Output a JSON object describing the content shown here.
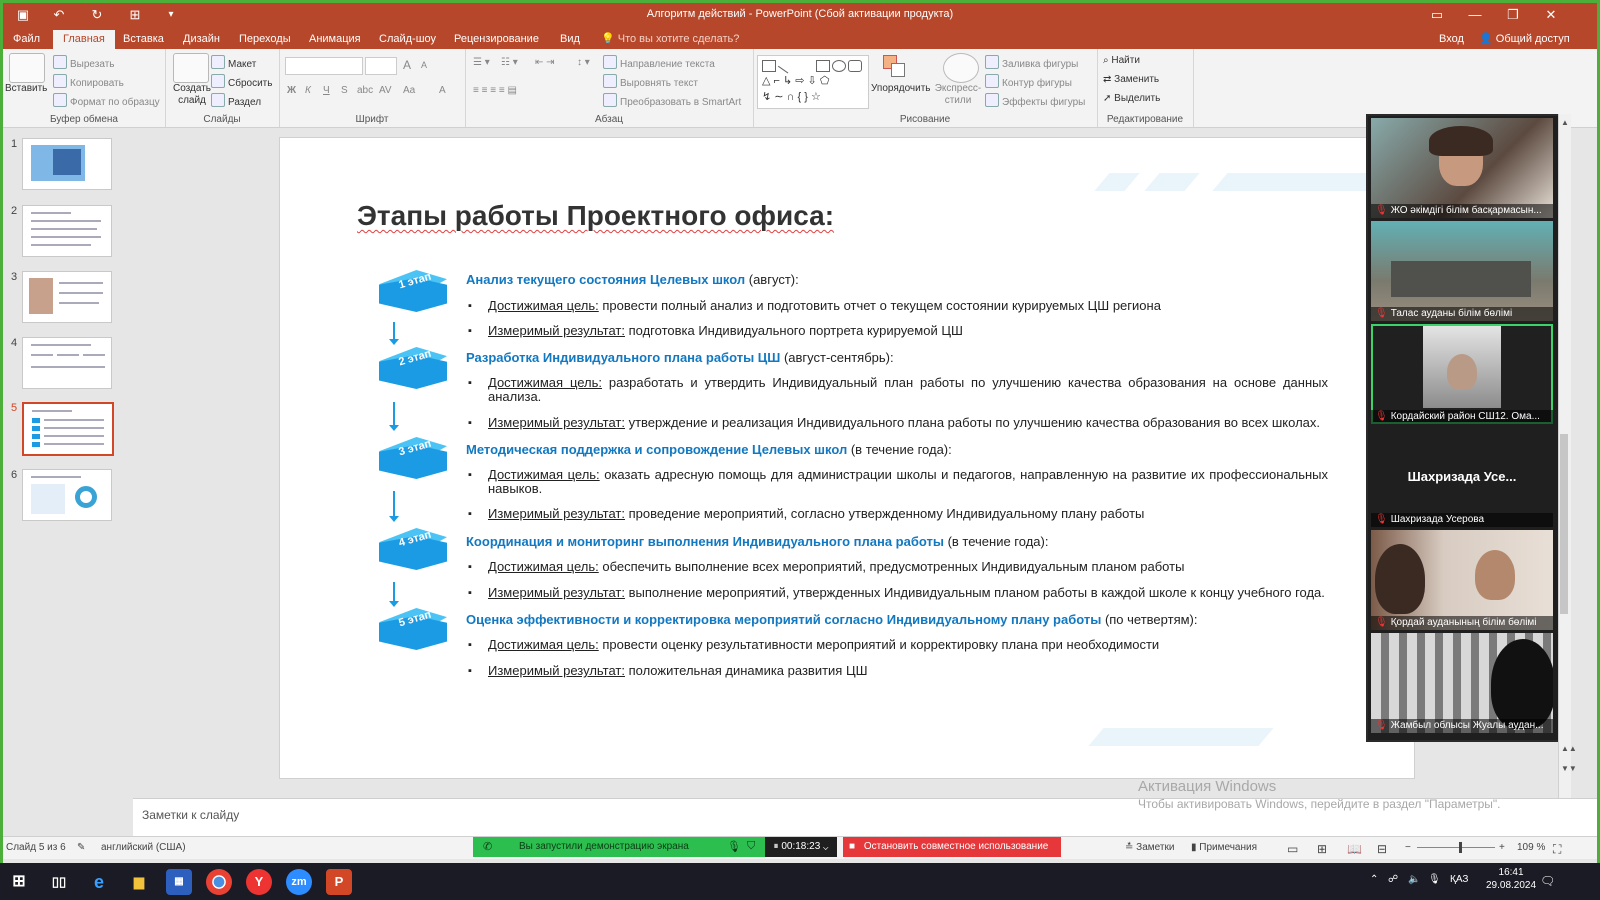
{
  "window": {
    "title": "Алгоритм действий - PowerPoint (Сбой активации продукта)"
  },
  "tabs": [
    "Файл",
    "Главная",
    "Вставка",
    "Дизайн",
    "Переходы",
    "Анимация",
    "Слайд-шоу",
    "Рецензирование",
    "Вид"
  ],
  "tell_me": "Что вы хотите сделать?",
  "account": {
    "signin": "Вход",
    "share": "Общий доступ"
  },
  "ribbon": {
    "clipboard": {
      "label": "Буфер обмена",
      "paste": "Вставить",
      "cut": "Вырезать",
      "copy": "Копировать",
      "format_painter": "Формат по образцу"
    },
    "slides": {
      "label": "Слайды",
      "new_slide": "Создать слайд",
      "layout": "Макет",
      "reset": "Сбросить",
      "section": "Раздел"
    },
    "font": {
      "label": "Шрифт",
      "bold": "Ж",
      "italic": "К",
      "underline": "Ч",
      "strike": "S",
      "shadow": "abc",
      "spacing": "AV",
      "case": "Aa",
      "grow": "A",
      "shrink": "A",
      "color": "A"
    },
    "paragraph": {
      "label": "Абзац",
      "text_direction": "Направление текста",
      "align_text": "Выровнять текст",
      "smartart": "Преобразовать в SmartArt"
    },
    "drawing": {
      "label": "Рисование",
      "arrange": "Упорядочить",
      "quick_styles": "Экспресс-стили",
      "fill": "Заливка фигуры",
      "outline": "Контур фигуры",
      "effects": "Эффекты фигуры"
    },
    "editing": {
      "label": "Редактирование",
      "find": "Найти",
      "replace": "Заменить",
      "select": "Выделить"
    }
  },
  "thumbnails": [
    "1",
    "2",
    "3",
    "4",
    "5",
    "6"
  ],
  "selected_slide": 5,
  "slide": {
    "title": "Этапы работы Проектного офиса:",
    "stages": [
      {
        "badge": "1 этап",
        "title": "Анализ текущего состояния Целевых школ",
        "period": " (август):",
        "goal_label": "Достижимая цель:",
        "goal": " провести полный анализ и подготовить отчет о текущем состоянии курируемых ЦШ региона",
        "result_label": "Измеримый результат:",
        "result": " подготовка Индивидуального портрета курируемой ЦШ"
      },
      {
        "badge": "2 этап",
        "title": "Разработка Индивидуального плана работы ЦШ",
        "period": "  (август-сентябрь):",
        "goal_label": "Достижимая цель:",
        "goal": " разработать и утвердить Индивидуальный план работы по улучшению качества образования на основе данных анализа.",
        "result_label": "Измеримый результат:",
        "result": " утверждение и реализация Индивидуального плана работы по улучшению качества образования во всех школах."
      },
      {
        "badge": "3 этап",
        "title": "Методическая поддержка и сопровождение Целевых школ",
        "period": " (в течение года):",
        "goal_label": "Достижимая цель:",
        "goal": " оказать адресную помощь для администрации школы и педагогов, направленную на развитие их профессиональных навыков.",
        "result_label": "Измеримый результат:",
        "result": " проведение мероприятий, согласно утвержденному Индивидуальному плану работы"
      },
      {
        "badge": "4 этап",
        "title": "Координация и мониторинг выполнения Индивидуального плана работы",
        "period": " (в течение года):",
        "goal_label": "Достижимая цель:",
        "goal": " обеспечить выполнение всех мероприятий, предусмотренных Индивидуальным планом работы",
        "result_label": "Измеримый результат:",
        "result": " выполнение мероприятий, утвержденных Индивидуальным планом работы в каждой школе к концу учебного года."
      },
      {
        "badge": "5 этап",
        "title": "Оценка эффективности и корректировка мероприятий согласно Индивидуальному плану работы",
        "period": " (по четвертям):",
        "goal_label": "Достижимая цель:",
        "goal": " провести оценку результативности мероприятий и корректировку плана при необходимости",
        "result_label": "Измеримый результат:",
        "result": " положительная динамика развития ЦШ"
      }
    ]
  },
  "participants": [
    {
      "name": "ЖО әкімдігі білім басқармасын...",
      "bg": "#6d5a4c"
    },
    {
      "name": "Талас ауданы білім бөлімі",
      "bg": "#3d7a7a"
    },
    {
      "name": "Кордайский район СШ12. Ома...",
      "bg": "#8a8a8a",
      "active": true
    },
    {
      "name": "Шахризада Усерова",
      "bg": "#1f1f1f",
      "display": "Шахризада Усе..."
    },
    {
      "name": "Қордай ауданының білім бөлімі",
      "bg": "#a89a90"
    },
    {
      "name": "Жамбыл облысы Жуалы аудан...",
      "bg": "#5f5f5f"
    }
  ],
  "notes_placeholder": "Заметки к слайду",
  "activation": {
    "title": "Активация Windows",
    "message": "Чтобы активировать Windows, перейдите в раздел \"Параметры\"."
  },
  "status": {
    "slide_info": "Слайд 5 из 6",
    "language": "английский (США)",
    "share_message": "Вы запустили демонстрацию экрана",
    "timer": "00:18:23",
    "stop_share": "Остановить совместное использование",
    "notes": "Заметки",
    "comments": "Примечания",
    "zoom": "109 %",
    "zoom_level": 0.55
  },
  "taskbar": {
    "keyboard": "ҚАЗ",
    "time": "16:41",
    "date": "29.08.2024"
  },
  "colors": {
    "accent": "#b7472a",
    "heading_blue": "#1178c1",
    "stage_blue": "#1a9be3",
    "share_green": "#2dbe50",
    "stop_red": "#e6373a"
  }
}
